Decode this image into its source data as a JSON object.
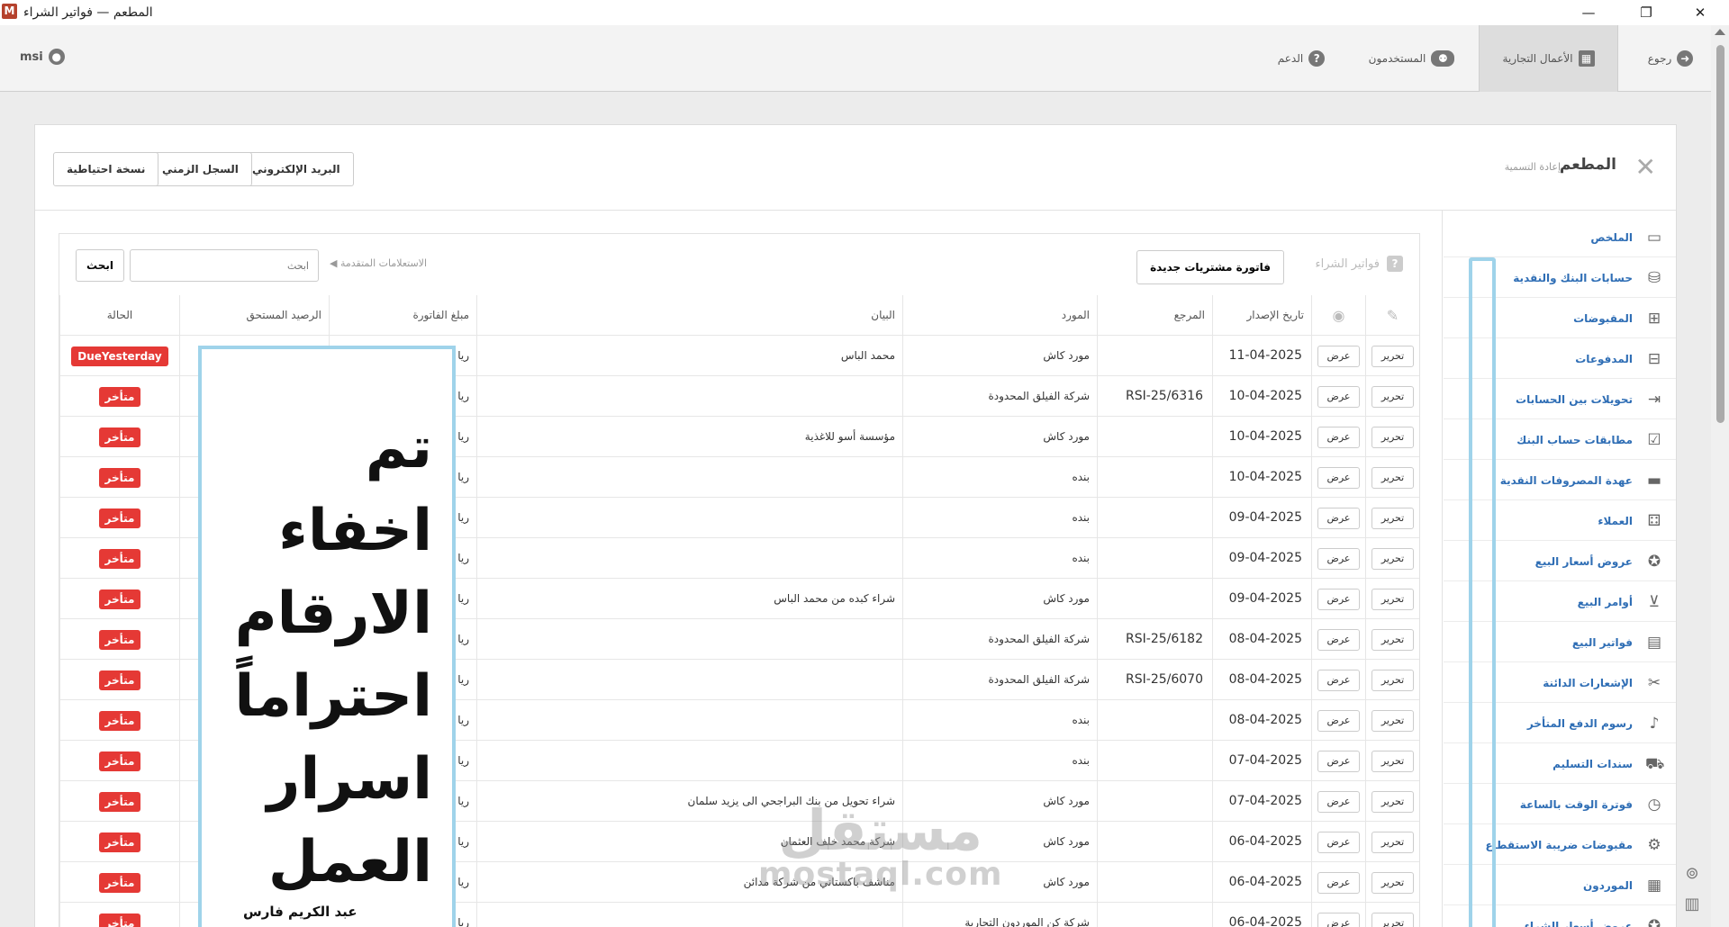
{
  "window": {
    "app_icon": "M",
    "title": "المطعم — فواتير الشراء",
    "minimize": "—",
    "maximize": "❐",
    "close": "✕"
  },
  "nav": {
    "back": "رجوع",
    "business": "الأعمال التجارية",
    "users": "المستخدمون",
    "support": "الدعم",
    "user_name": "msi"
  },
  "header": {
    "company": "المطعم",
    "rename": "إعادة التسمية",
    "buttons": {
      "email": "البريد الإلكتروني",
      "history": "السجل الزمني",
      "backup": "نسخة احتياطية"
    }
  },
  "sidebar": {
    "items": [
      {
        "label": "الملخص",
        "icon": "presentation-icon"
      },
      {
        "label": "حسابات البنك والنقدية",
        "icon": "coins-icon"
      },
      {
        "label": "المقبوضات",
        "icon": "plus-square-icon"
      },
      {
        "label": "المدفوعات",
        "icon": "minus-square-icon"
      },
      {
        "label": "تحويلات بين الحسابات",
        "icon": "arrow-in-icon"
      },
      {
        "label": "مطابقات حساب البنك",
        "icon": "clipboard-check-icon"
      },
      {
        "label": "عهدة المصروفات النقدية",
        "icon": "credit-card-icon"
      },
      {
        "label": "العملاء",
        "icon": "users-board-icon"
      },
      {
        "label": "عروض أسعار البيع",
        "icon": "quote-icon"
      },
      {
        "label": "أوامر البيع",
        "icon": "basket-icon"
      },
      {
        "label": "فواتير البيع",
        "icon": "file-icon"
      },
      {
        "label": "الإشعارات الدائنة",
        "icon": "scissors-icon"
      },
      {
        "label": "رسوم الدفع المتأخر",
        "icon": "bell-icon"
      },
      {
        "label": "سندات التسليم",
        "icon": "truck-icon"
      },
      {
        "label": "فوترة الوقت بالساعة",
        "icon": "stopwatch-icon"
      },
      {
        "label": "مقبوضات ضريبة الاستقطاع",
        "icon": "tax-icon"
      },
      {
        "label": "الموردون",
        "icon": "building-icon"
      },
      {
        "label": "عروض أسعار الشراء",
        "icon": "quote-purchase-icon"
      }
    ]
  },
  "content": {
    "section_title": "فواتير الشراء",
    "new_invoice": "فاتورة مشتريات جديدة",
    "advanced_search": "◀ الاستعلامات المتقدمة",
    "search_placeholder": "ابحث",
    "search_button": "ابحث",
    "columns": {
      "issue_date": "تاريخ الإصدار",
      "reference": "المرجع",
      "supplier": "المورد",
      "description": "البيان",
      "invoice_amount": "مبلغ الفاتورة",
      "balance_due": "الرصيد المستحق",
      "status": "الحالة"
    },
    "edit_label": "تحرير",
    "view_label": "عرض",
    "rows": [
      {
        "date": "11-04-2025",
        "ref": "",
        "supplier": "مورد كاش",
        "desc": "محمد الباس",
        "amount": "ريا",
        "status": "DueYesterday"
      },
      {
        "date": "10-04-2025",
        "ref": "RSI-25/6316",
        "supplier": "شركة الفيلق المحدودة",
        "desc": "",
        "amount": "ريا",
        "status": "متأخر"
      },
      {
        "date": "10-04-2025",
        "ref": "",
        "supplier": "مورد كاش",
        "desc": "مؤسسة أسو للاغذية",
        "amount": "ريا",
        "status": "متأخر"
      },
      {
        "date": "10-04-2025",
        "ref": "",
        "supplier": "بنده",
        "desc": "",
        "amount": "ريا",
        "status": "متأخر"
      },
      {
        "date": "09-04-2025",
        "ref": "",
        "supplier": "بنده",
        "desc": "",
        "amount": "ريا",
        "status": "متأخر"
      },
      {
        "date": "09-04-2025",
        "ref": "",
        "supplier": "بنده",
        "desc": "",
        "amount": "ريا",
        "status": "متأخر"
      },
      {
        "date": "09-04-2025",
        "ref": "",
        "supplier": "مورد كاش",
        "desc": "شراء كبده من محمد الباس",
        "amount": "ريا",
        "status": "متأخر"
      },
      {
        "date": "08-04-2025",
        "ref": "RSI-25/6182",
        "supplier": "شركة الفيلق المحدودة",
        "desc": "",
        "amount": "ريا",
        "status": "متأخر"
      },
      {
        "date": "08-04-2025",
        "ref": "RSI-25/6070",
        "supplier": "شركة الفيلق المحدودة",
        "desc": "",
        "amount": "ريا",
        "status": "متأخر"
      },
      {
        "date": "08-04-2025",
        "ref": "",
        "supplier": "بنده",
        "desc": "",
        "amount": "ريا",
        "status": "متأخر"
      },
      {
        "date": "07-04-2025",
        "ref": "",
        "supplier": "بنده",
        "desc": "",
        "amount": "ريا",
        "status": "متأخر"
      },
      {
        "date": "07-04-2025",
        "ref": "",
        "supplier": "مورد كاش",
        "desc": "شراء تحويل من بنك البراجحي الى يزيد سلمان",
        "amount": "ريا",
        "status": "متأخر"
      },
      {
        "date": "06-04-2025",
        "ref": "",
        "supplier": "مورد كاش",
        "desc": "شركة محمد خلف العثمان",
        "amount": "ريا",
        "status": "متأخر"
      },
      {
        "date": "06-04-2025",
        "ref": "",
        "supplier": "مورد كاش",
        "desc": "مناشف باكستاني من شركة مدائن",
        "amount": "ريا",
        "status": "متأخر"
      },
      {
        "date": "06-04-2025",
        "ref": "",
        "supplier": "شركة كن الموردون التجارية",
        "desc": "",
        "amount": "ريا",
        "status": "متأخر"
      }
    ]
  },
  "overlay": {
    "message": "تم اخفاء الارقام احتراماً اسرار العمل",
    "signature": "عبد الكريم فارس"
  },
  "watermark": {
    "ar": "مستقل",
    "en": "mostaql.com"
  },
  "colors": {
    "status_red": "#e53935",
    "link_blue": "#2f6eb5",
    "highlight": "#9fd3ea"
  }
}
